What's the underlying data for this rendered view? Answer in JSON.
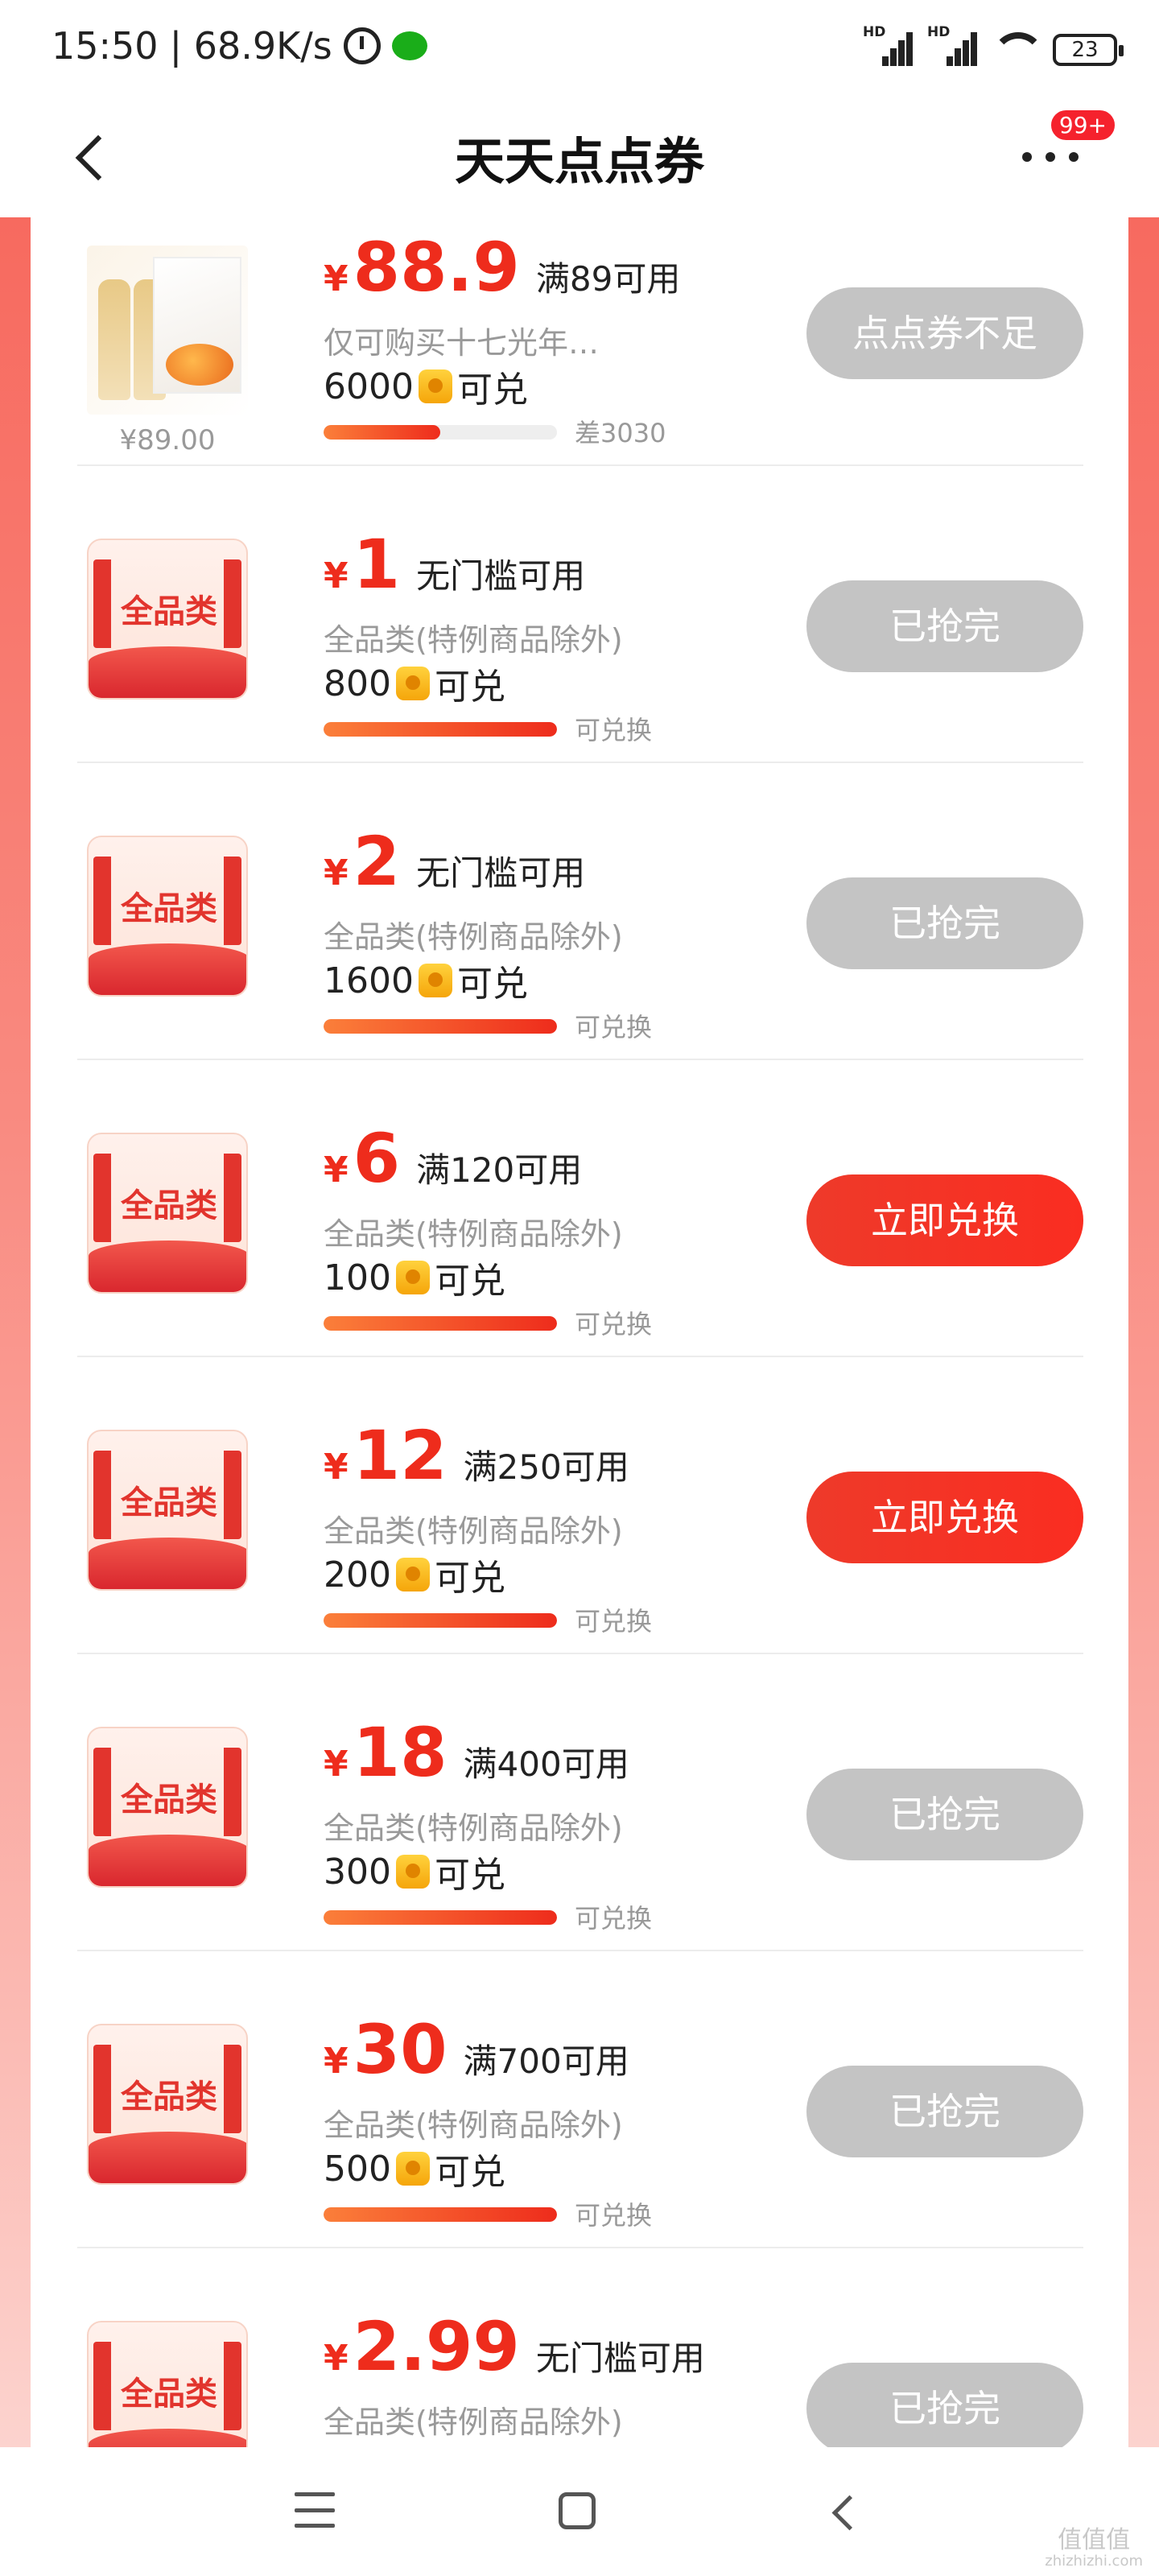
{
  "status_bar": {
    "time": "15:50",
    "speed": "| 68.9K/s",
    "battery": "23",
    "signal_label": "HD"
  },
  "nav": {
    "title": "天天点点券",
    "badge": "99+"
  },
  "coupons": [
    {
      "amount": "88.9",
      "condition": "满89可用",
      "desc": "仅可购买十七光年…",
      "cost": "6000",
      "cost_suffix": "可兑",
      "progress": 0.5,
      "progress_note": "差3030",
      "button": "点点券不足",
      "button_state": "disabled",
      "product_price": "¥89.00"
    },
    {
      "amount": "1",
      "condition": "无门槛可用",
      "desc": "全品类(特例商品除外)",
      "cost": "800",
      "cost_suffix": "可兑",
      "progress": 1,
      "progress_note": "可兑换",
      "button": "已抢完",
      "button_state": "disabled",
      "category": "全品类"
    },
    {
      "amount": "2",
      "condition": "无门槛可用",
      "desc": "全品类(特例商品除外)",
      "cost": "1600",
      "cost_suffix": "可兑",
      "progress": 1,
      "progress_note": "可兑换",
      "button": "已抢完",
      "button_state": "disabled",
      "category": "全品类"
    },
    {
      "amount": "6",
      "condition": "满120可用",
      "desc": "全品类(特例商品除外)",
      "cost": "100",
      "cost_suffix": "可兑",
      "progress": 1,
      "progress_note": "可兑换",
      "button": "立即兑换",
      "button_state": "active",
      "category": "全品类"
    },
    {
      "amount": "12",
      "condition": "满250可用",
      "desc": "全品类(特例商品除外)",
      "cost": "200",
      "cost_suffix": "可兑",
      "progress": 1,
      "progress_note": "可兑换",
      "button": "立即兑换",
      "button_state": "active",
      "category": "全品类"
    },
    {
      "amount": "18",
      "condition": "满400可用",
      "desc": "全品类(特例商品除外)",
      "cost": "300",
      "cost_suffix": "可兑",
      "progress": 1,
      "progress_note": "可兑换",
      "button": "已抢完",
      "button_state": "disabled",
      "category": "全品类"
    },
    {
      "amount": "30",
      "condition": "满700可用",
      "desc": "全品类(特例商品除外)",
      "cost": "500",
      "cost_suffix": "可兑",
      "progress": 1,
      "progress_note": "可兑换",
      "button": "已抢完",
      "button_state": "disabled",
      "category": "全品类"
    },
    {
      "amount": "2.99",
      "condition": "无门槛可用",
      "desc": "全品类(特例商品除外)",
      "cost": "",
      "cost_suffix": "",
      "progress": 1,
      "progress_note": "",
      "button": "已抢完",
      "button_state": "disabled",
      "category": "全品类"
    }
  ],
  "currency_symbol": "¥",
  "watermark": {
    "main": "值值值",
    "sub": "zhizhizhi.com"
  },
  "colors": {
    "accent": "#ee2c1c",
    "disabled_button": "#c4c4c4",
    "active_button": "#f52f22"
  }
}
